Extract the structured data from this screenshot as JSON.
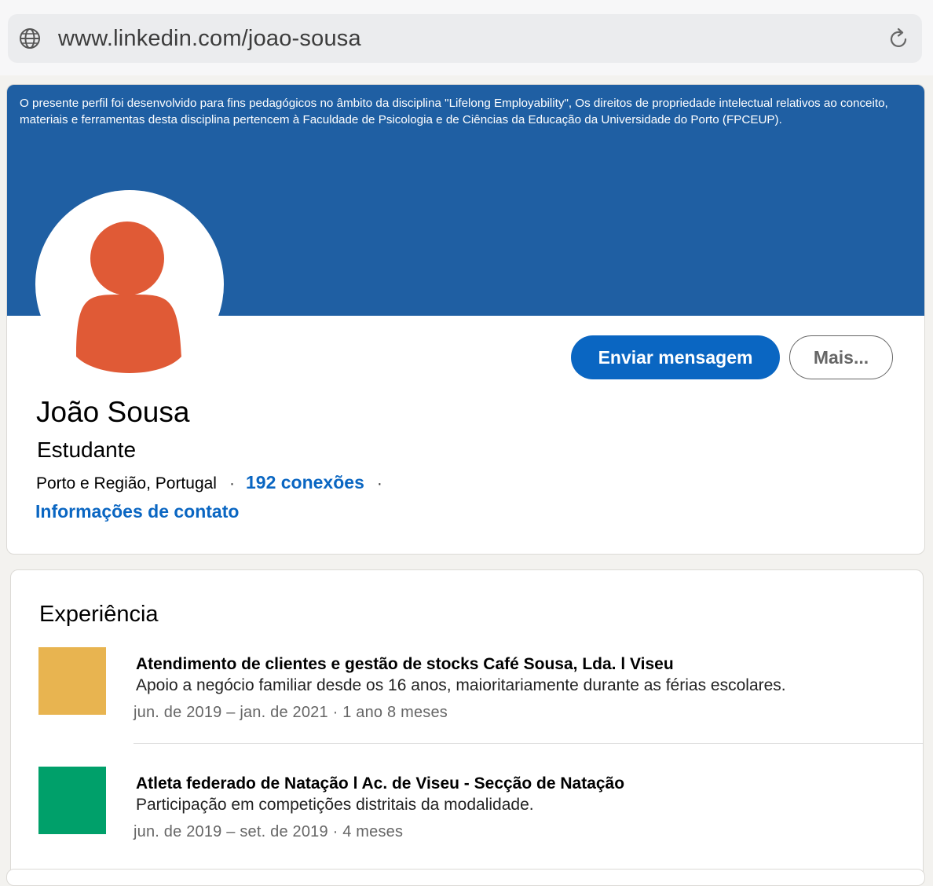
{
  "browser": {
    "url": "www.linkedin.com/joao-sousa",
    "globe_icon": "globe-icon",
    "reload_icon": "reload-icon"
  },
  "profile": {
    "banner_notice": "O presente perfil foi desenvolvido para fins pedagógicos no âmbito da disciplina \"Lifelong Employability\", Os direitos de propriedade intelectual relativos ao conceito, materiais e ferramentas desta disciplina pertencem à Faculdade de Psicologia e de Ciências da Educação da Universidade do Porto (FPCEUP).",
    "banner_color": "#1f5fa3",
    "avatar_color": "#e05a36",
    "name": "João Sousa",
    "headline": "Estudante",
    "location": "Porto e Região, Portugal",
    "separator": "·",
    "connections": "192 conexões",
    "contact_info": "Informações de contato",
    "send_message_label": "Enviar mensagem",
    "more_label": "Mais...",
    "accent_color": "#0a66c2"
  },
  "experience": {
    "title": "Experiência",
    "items": [
      {
        "title": "Atendimento de clientes e gestão de stocks Café Sousa, Lda. l Viseu",
        "description": "Apoio a negócio familiar desde os 16 anos, maioritariamente durante as férias escolares.",
        "dates": "jun. de 2019 – jan. de 2021 · 1 ano 8 meses",
        "logo_color": "#e8b450"
      },
      {
        "title": "Atleta federado de Natação l Ac. de Viseu - Secção de Natação",
        "description": "Participação em competições distritais da modalidade.",
        "dates": "jun. de 2019 – set. de 2019 · 4 meses",
        "logo_color": "#00a06a"
      }
    ]
  }
}
